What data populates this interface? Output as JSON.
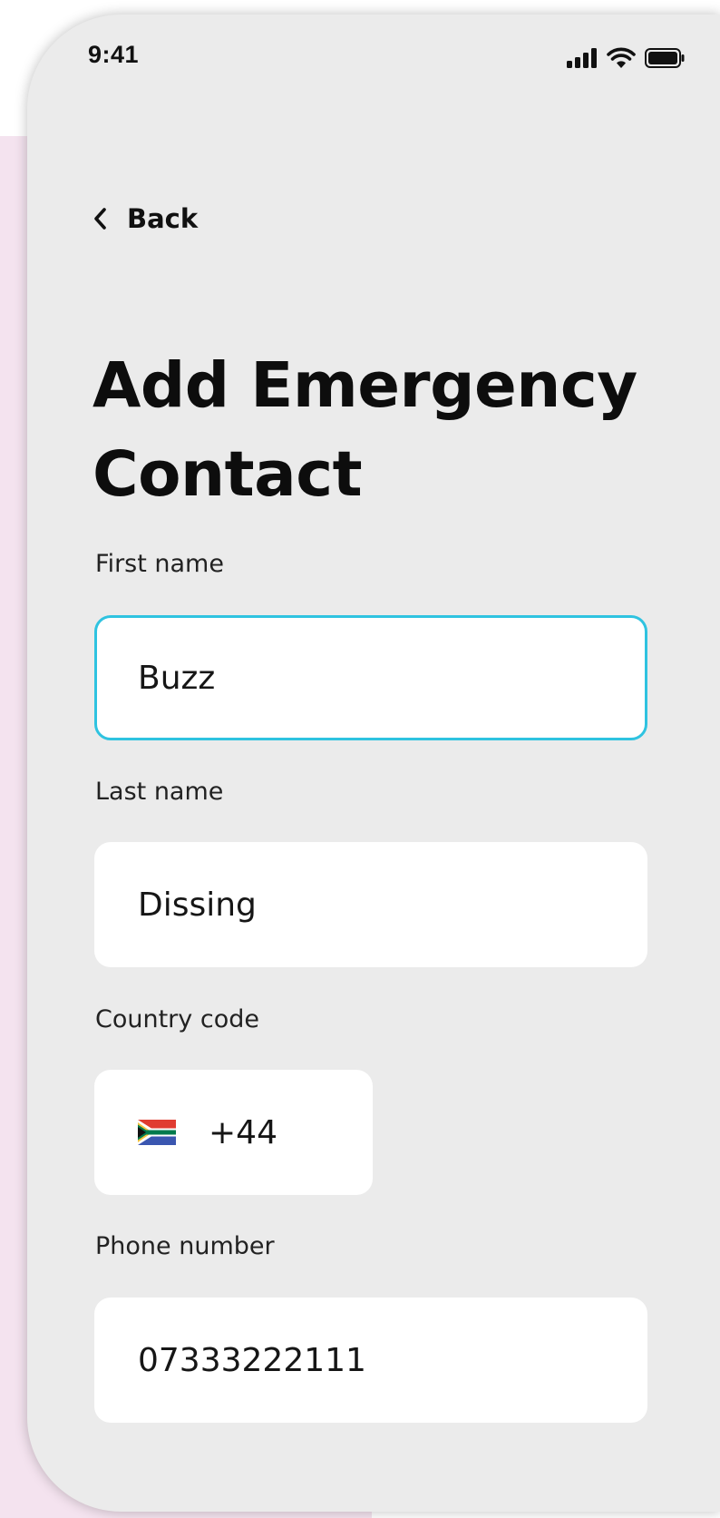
{
  "status_bar": {
    "time": "9:41"
  },
  "nav": {
    "back_label": "Back"
  },
  "page": {
    "title_line1": "Add Emergency",
    "title_line2": "Contact"
  },
  "form": {
    "first_name": {
      "label": "First name",
      "value": "Buzz"
    },
    "last_name": {
      "label": "Last name",
      "value": "Dissing"
    },
    "country_code": {
      "label": "Country code",
      "value": "+44",
      "flag_icon": "south-africa-flag-icon"
    },
    "phone_number": {
      "label": "Phone number",
      "value": "07333222111"
    }
  },
  "colors": {
    "focus_border": "#2fc3e0",
    "screen_bg": "#ebebeb",
    "backdrop_pink": "#f4e3ef"
  }
}
